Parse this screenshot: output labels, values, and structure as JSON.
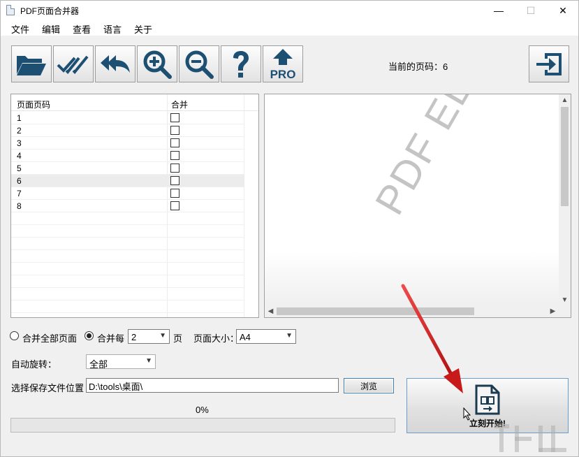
{
  "window": {
    "title": "PDF页面合并器",
    "controls": {
      "minimize": "—",
      "maximize": "☐",
      "close": "✕"
    }
  },
  "menu": [
    "文件",
    "编辑",
    "查看",
    "语言",
    "关于"
  ],
  "toolbar": {
    "buttons": [
      {
        "name": "open-folder-icon"
      },
      {
        "name": "check-all-icon"
      },
      {
        "name": "reply-all-icon"
      },
      {
        "name": "zoom-in-icon"
      },
      {
        "name": "zoom-out-icon"
      },
      {
        "name": "help-icon"
      },
      {
        "name": "upgrade-pro-icon",
        "label": "PRO"
      },
      {
        "name": "exit-icon"
      }
    ],
    "current_page": "当前的页码：6"
  },
  "page_list": {
    "columns": [
      "页面页码",
      "合并"
    ],
    "rows": [
      {
        "page": "1",
        "merge": false
      },
      {
        "page": "2",
        "merge": false
      },
      {
        "page": "3",
        "merge": false
      },
      {
        "page": "4",
        "merge": false
      },
      {
        "page": "5",
        "merge": false
      },
      {
        "page": "6",
        "merge": false,
        "selected": true
      },
      {
        "page": "7",
        "merge": false
      },
      {
        "page": "8",
        "merge": false
      }
    ]
  },
  "preview": {
    "watermark": "PDF EDIT"
  },
  "options": {
    "merge_all_label": "合并全部页面",
    "merge_every_label": "合并每",
    "merge_every_value": "2",
    "pages_unit": "页",
    "page_size_label": "页面大小：",
    "page_size_value": "A4",
    "auto_rotate_label": "自动旋转：",
    "auto_rotate_value": "全部",
    "selected_mode": "merge_every"
  },
  "output": {
    "save_location_label": "选择保存文件位置",
    "path_value": "D:\\tools\\桌面\\",
    "browse_label": "浏览"
  },
  "progress": {
    "percent_text": "0%",
    "value": 0
  },
  "start_button": {
    "label": "立刻开始!"
  },
  "colors": {
    "arrow": "#d42020",
    "progress": "#06b025",
    "button_border": "#3c7fb1"
  }
}
